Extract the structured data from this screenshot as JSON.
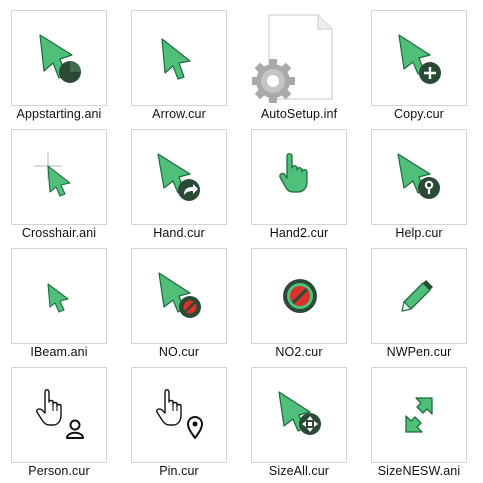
{
  "files": [
    {
      "name": "Appstarting.ani",
      "icon": "appstarting-cursor-icon"
    },
    {
      "name": "Arrow.cur",
      "icon": "arrow-cursor-icon"
    },
    {
      "name": "AutoSetup.inf",
      "icon": "setup-information-file-icon"
    },
    {
      "name": "Copy.cur",
      "icon": "copy-cursor-icon"
    },
    {
      "name": "Crosshair.ani",
      "icon": "crosshair-cursor-icon"
    },
    {
      "name": "Hand.cur",
      "icon": "hand-link-cursor-icon"
    },
    {
      "name": "Hand2.cur",
      "icon": "hand-pointer-cursor-icon"
    },
    {
      "name": "Help.cur",
      "icon": "help-cursor-icon"
    },
    {
      "name": "IBeam.ani",
      "icon": "ibeam-cursor-icon"
    },
    {
      "name": "NO.cur",
      "icon": "no-cursor-icon"
    },
    {
      "name": "NO2.cur",
      "icon": "no-symbol-cursor-icon"
    },
    {
      "name": "NWPen.cur",
      "icon": "pen-cursor-icon"
    },
    {
      "name": "Person.cur",
      "icon": "person-select-cursor-icon"
    },
    {
      "name": "Pin.cur",
      "icon": "pin-select-cursor-icon"
    },
    {
      "name": "SizeAll.cur",
      "icon": "size-all-cursor-icon"
    },
    {
      "name": "SizeNESW.ani",
      "icon": "size-nesw-cursor-icon"
    }
  ],
  "colors": {
    "cursor_fill": "#4fbf7a",
    "cursor_outline": "#1f6b3d",
    "badge": "#2b4a35",
    "no_red": "#d8322b"
  }
}
